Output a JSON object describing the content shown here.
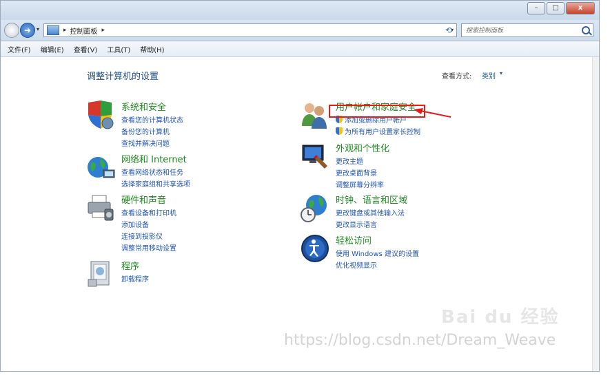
{
  "window": {
    "minimize": "–",
    "maximize": "□",
    "close": "x"
  },
  "address": {
    "path": "控制面板",
    "separator": "▸",
    "search_placeholder": "搜索控制面板"
  },
  "menu": [
    "文件(F)",
    "编辑(E)",
    "查看(V)",
    "工具(T)",
    "帮助(H)"
  ],
  "page": {
    "title": "调整计算机的设置",
    "view_label": "查看方式:",
    "view_value": "类别"
  },
  "categories": {
    "system": {
      "title": "系统和安全",
      "links": [
        "查看您的计算机状态",
        "备份您的计算机",
        "查找并解决问题"
      ]
    },
    "network": {
      "title": "网络和 Internet",
      "links": [
        "查看网络状态和任务",
        "选择家庭组和共享选项"
      ]
    },
    "hardware": {
      "title": "硬件和声音",
      "links": [
        "查看设备和打印机",
        "添加设备",
        "连接到投影仪",
        "调整常用移动设置"
      ]
    },
    "programs": {
      "title": "程序",
      "links": [
        "卸载程序"
      ]
    },
    "users": {
      "title": "用户帐户和家庭安全",
      "links": [
        "添加或删除用户帐户",
        "为所有用户设置家长控制"
      ]
    },
    "appearance": {
      "title": "外观和个性化",
      "links": [
        "更改主题",
        "更改桌面背景",
        "调整屏幕分辨率"
      ]
    },
    "clock": {
      "title": "时钟、语言和区域",
      "links": [
        "更改键盘或其他输入法",
        "更改显示语言"
      ]
    },
    "ease": {
      "title": "轻松访问",
      "links": [
        "使用 Windows 建议的设置",
        "优化视频显示"
      ]
    }
  },
  "watermark": {
    "brand": "Bai du 经验",
    "url": "https://blog.csdn.net/Dream_Weave"
  },
  "colors": {
    "category_title": "#1f8a1f",
    "link": "#2156b4",
    "highlight": "#e31b1b"
  }
}
